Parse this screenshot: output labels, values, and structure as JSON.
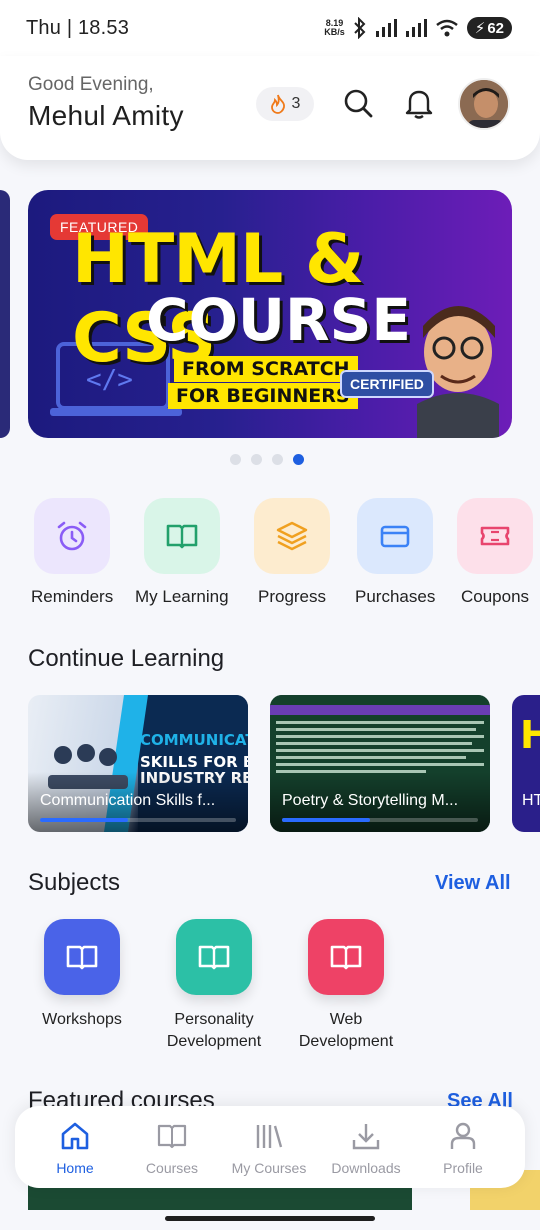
{
  "status_bar": {
    "time": "Thu | 18.53",
    "net_speed_value": "8.19",
    "net_speed_unit": "KB/s",
    "battery": "62"
  },
  "header": {
    "greeting": "Good Evening,",
    "user_name": "Mehul Amity",
    "streak_count": "3",
    "icons": [
      "flame-icon",
      "search-icon",
      "bell-icon",
      "avatar"
    ]
  },
  "banner": {
    "badge": "FEATURED",
    "title": "HTML & CSS",
    "subtitle": "COURSE",
    "line1": "FROM SCRATCH",
    "line2": "FOR BEGINNERS",
    "certified": "CERTIFIED",
    "slide_count": 4,
    "active_slide": 4
  },
  "quick_actions": [
    {
      "label": "Reminders",
      "icon": "alarm-clock-icon",
      "color": "#8a5cf6",
      "bg": "#ece6fd"
    },
    {
      "label": "My Learning",
      "icon": "open-book-icon",
      "color": "#22a06b",
      "bg": "#d9f5e8"
    },
    {
      "label": "Progress",
      "icon": "layers-icon",
      "color": "#f0a020",
      "bg": "#fdeccf"
    },
    {
      "label": "Purchases",
      "icon": "credit-card-icon",
      "color": "#3b82f6",
      "bg": "#dbe8fd"
    },
    {
      "label": "Coupons",
      "icon": "ticket-icon",
      "color": "#e8456e",
      "bg": "#fde0ea"
    }
  ],
  "continue_learning": {
    "title": "Continue Learning",
    "cards": [
      {
        "title": "Communication Skills f...",
        "progress": 0.45,
        "thumb_text": "COMMUNICATION SKILLS FOR BEING INDUSTRY READY"
      },
      {
        "title": "Poetry & Storytelling M...",
        "progress": 0.45,
        "thumb_text": "ALL TYPES OF DATA INTERPRETATION IN ONE VIDEO"
      },
      {
        "title": "HT",
        "progress": 0.2,
        "thumb_text": "H"
      }
    ]
  },
  "subjects": {
    "title": "Subjects",
    "view_all": "View All",
    "items": [
      {
        "label_line1": "Workshops",
        "label_line2": "",
        "color": "#4a63e8"
      },
      {
        "label_line1": "Personality",
        "label_line2": "Development",
        "color": "#2cc0a6"
      },
      {
        "label_line1": "Web",
        "label_line2": "Development",
        "color": "#ee4266"
      }
    ]
  },
  "featured_courses": {
    "title": "Featured courses",
    "see_all": "See All"
  },
  "bottom_nav": [
    {
      "label": "Home",
      "icon": "home-icon",
      "active": true
    },
    {
      "label": "Courses",
      "icon": "book-icon",
      "active": false
    },
    {
      "label": "My Courses",
      "icon": "library-icon",
      "active": false
    },
    {
      "label": "Downloads",
      "icon": "download-icon",
      "active": false
    },
    {
      "label": "Profile",
      "icon": "user-icon",
      "active": false
    }
  ],
  "colors": {
    "accent": "#1e5fe0",
    "background": "#f6f7fb"
  }
}
